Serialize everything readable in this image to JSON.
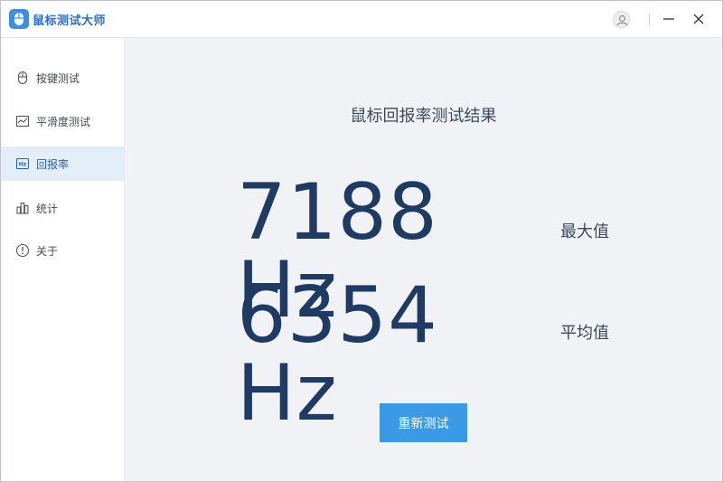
{
  "app": {
    "title": "鼠标测试大师"
  },
  "sidebar": {
    "items": [
      {
        "label": "按键测试",
        "icon": "mouse-icon"
      },
      {
        "label": "平滑度测试",
        "icon": "line-chart-icon"
      },
      {
        "label": "回报率",
        "icon": "hz-icon",
        "active": true
      },
      {
        "label": "统计",
        "icon": "bar-chart-icon"
      },
      {
        "label": "关于",
        "icon": "info-icon"
      }
    ]
  },
  "main": {
    "title": "鼠标回报率测试结果",
    "max_value": "7188 Hz",
    "max_label": "最大值",
    "avg_value": "6354 Hz",
    "avg_label": "平均值",
    "retest_label": "重新测试"
  },
  "colors": {
    "accent": "#3a9ae6",
    "value_text": "#1f3a63",
    "active_bg": "#e3eef9",
    "main_bg": "#f0f2f5"
  }
}
